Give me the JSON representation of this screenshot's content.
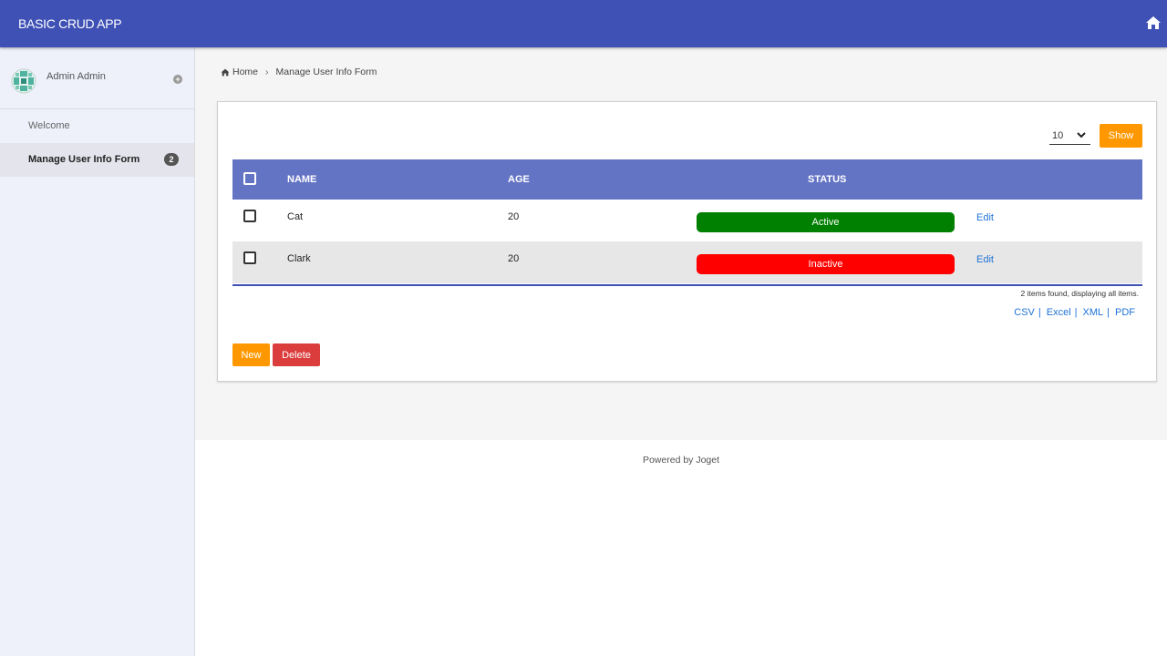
{
  "app": {
    "title": "BASIC CRUD APP"
  },
  "header": {
    "home_icon": "home-icon"
  },
  "sidebar": {
    "user_name": "Admin Admin",
    "user_toggle": "+",
    "items": [
      {
        "label": "Welcome",
        "active": false
      },
      {
        "label": "Manage User Info Form",
        "active": true,
        "badge": "2"
      }
    ]
  },
  "breadcrumb": {
    "home_label": "Home",
    "separator": "›",
    "current": "Manage User Info Form"
  },
  "list": {
    "page_size": "10",
    "show_label": "Show",
    "columns": [
      "NAME",
      "AGE",
      "STATUS"
    ],
    "rows": [
      {
        "name": "Cat",
        "age": "20",
        "status": "Active",
        "status_color": "#008000",
        "action": "Edit"
      },
      {
        "name": "Clark",
        "age": "20",
        "status": "Inactive",
        "status_color": "#ff0000",
        "action": "Edit"
      }
    ],
    "found_text": "2 items found, displaying all items.",
    "exports": [
      "CSV",
      "Excel",
      "XML",
      "PDF"
    ],
    "new_label": "New",
    "delete_label": "Delete"
  },
  "footer": {
    "text": "Powered by Joget"
  },
  "colors": {
    "header": "#3f51b5",
    "table_header": "#6474c4",
    "accent_orange": "#ff9800",
    "delete_red": "#db3d3d",
    "link_blue": "#1e72d6"
  }
}
